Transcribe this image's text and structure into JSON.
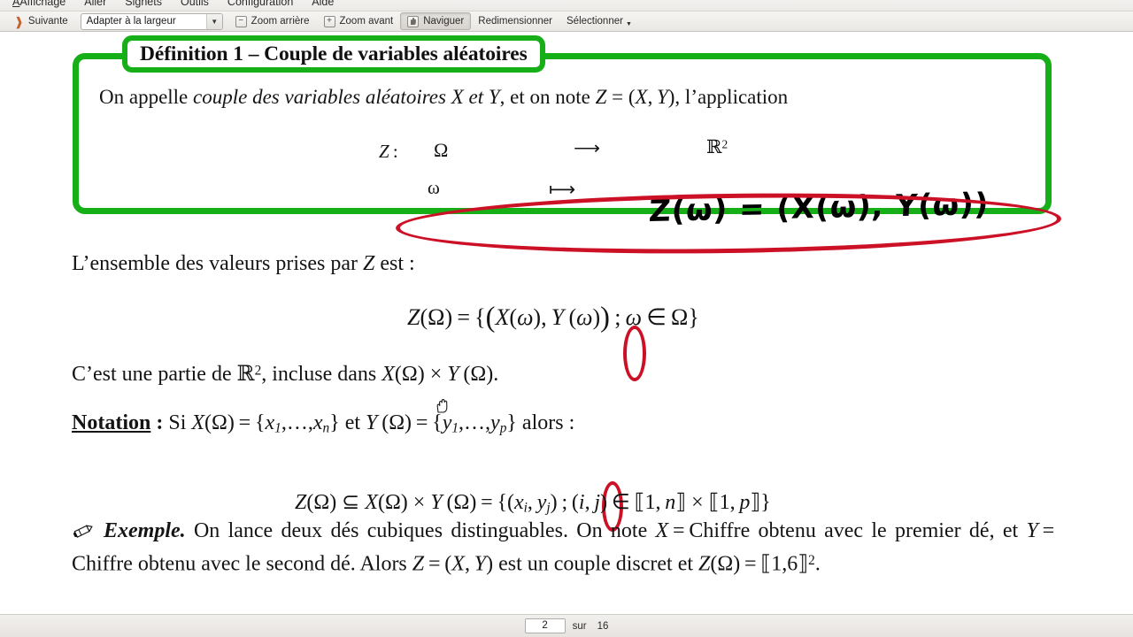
{
  "menubar": {
    "items": [
      {
        "label": "Affichage",
        "mnemonic": "A"
      },
      {
        "label": "Aller",
        "mnemonic": "A"
      },
      {
        "label": "Signets",
        "mnemonic": "S"
      },
      {
        "label": "Outils",
        "mnemonic": "O"
      },
      {
        "label": "Configuration",
        "mnemonic": "C"
      },
      {
        "label": "Aide",
        "mnemonic": "A"
      }
    ]
  },
  "toolbar": {
    "next_label": "Suivante",
    "zoom_combo_value": "Adapter à la largeur",
    "zoom_out_label": "Zoom arrière",
    "zoom_in_label": "Zoom avant",
    "browse_label": "Naviguer",
    "resize_label": "Redimensionner",
    "select_label": "Sélectionner"
  },
  "document": {
    "definition_box": {
      "title": "Définition 1 – Couple de variables aléatoires",
      "intro_pre": "On appelle ",
      "intro_italic": "couple des variables aléatoires X et Y",
      "intro_post": ", et on note Z = (X, Y), l’application",
      "map": {
        "name": "Z :",
        "domain": "Ω",
        "arrow": "⟶",
        "codomain": "ℝ",
        "codomain_exp": "2",
        "element": "ω",
        "maps_to": "⟼"
      },
      "handwriting": "Z(ω) = (X(ω), Y(ω))"
    },
    "line_ensemble": "L’ensemble des valeurs prises par Z est :",
    "equation_1": "Z(Ω) = {(X(ω), Y(ω)) ; ω ∈ Ω}",
    "line_partie": "C’est une partie de ℝ2, incluse dans X(Ω) × Y(Ω).",
    "notation": {
      "label": "Notation",
      "colon": " : ",
      "text": "Si X(Ω) = {x1,…,xn} et Y(Ω) = {y1,…,yp} alors :"
    },
    "equation_2": "Z(Ω) ⊆ X(Ω) × Y(Ω) = {(xi, yj) ; (i, j) ∈ ⟦1, n⟧ × ⟦1, p⟧}",
    "example": {
      "label": "Exemple.",
      "text": "On lance deux dés cubiques distinguables. On note X = Chiffre obtenu avec le premier dé, et Y = Chiffre obtenu avec le second dé. Alors Z = (X, Y) est un couple discret et Z(Ω) = ⟦1,6⟧2."
    }
  },
  "statusbar": {
    "current_page": "2",
    "of_label": "sur",
    "total_pages": "16"
  },
  "colors": {
    "green_box": "#17af17",
    "red_annotation": "#cc1127",
    "next_arrow": "#c8612a"
  }
}
